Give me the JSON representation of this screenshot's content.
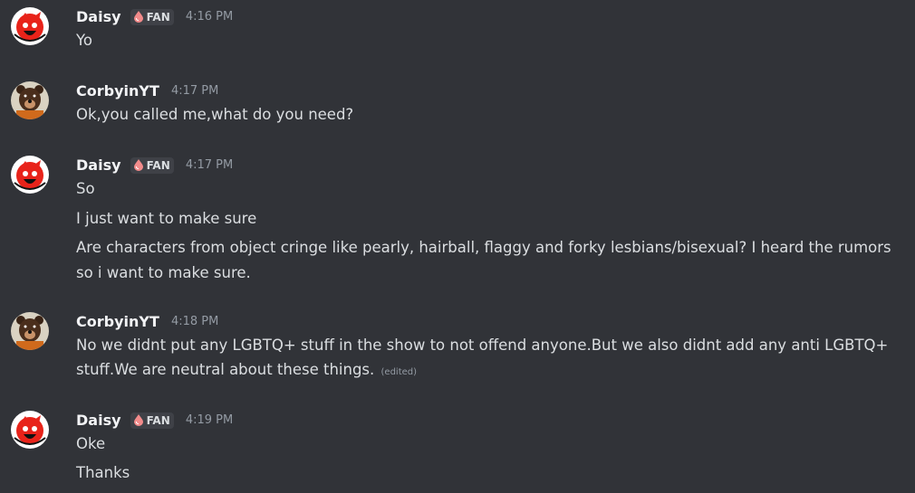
{
  "messages": [
    {
      "author": "Daisy",
      "badge": "FAN",
      "time": "4:16 PM",
      "avatar": "daisy-avatar",
      "lines": [
        "Yo"
      ]
    },
    {
      "author": "CorbyinYT",
      "time": "4:17 PM",
      "avatar": "bear-avatar",
      "lines": [
        "Ok,you called me,what do you need?"
      ]
    },
    {
      "author": "Daisy",
      "badge": "FAN",
      "time": "4:17 PM",
      "avatar": "daisy-avatar",
      "lines": [
        "So",
        "I just want to make sure",
        "Are characters from object cringe like pearly, hairball, flaggy and forky lesbians/bisexual? I heard the rumors",
        "so i want to make sure."
      ]
    },
    {
      "author": "CorbyinYT",
      "time": "4:18 PM",
      "avatar": "bear-avatar",
      "lines": [
        "No we didnt put any LGBTQ+ stuff in the show to not offend anyone.But we also didnt add any anti LGBTQ+",
        "stuff.We are neutral about these things."
      ],
      "edited_label": "(edited)"
    },
    {
      "author": "Daisy",
      "badge": "FAN",
      "time": "4:19 PM",
      "avatar": "daisy-avatar",
      "lines": [
        "Oke",
        "Thanks"
      ]
    }
  ],
  "colors": {
    "background": "#313338",
    "username": "#f2f3f5",
    "text": "#dbdee1",
    "timestamp": "#949ba4",
    "badge_bg": "#3f4147",
    "badge_drop": "#f28b8b"
  }
}
